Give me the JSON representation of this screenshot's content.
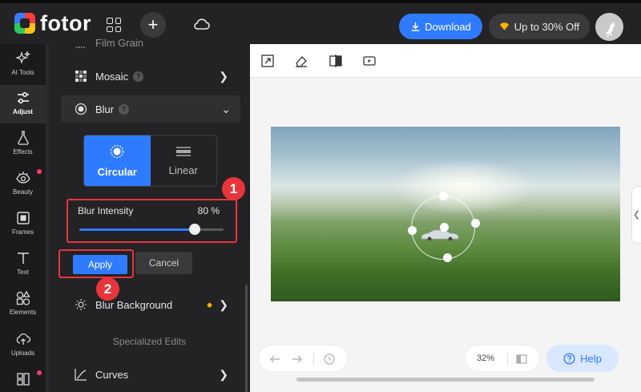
{
  "app": {
    "logo_text": "fotor"
  },
  "header": {
    "download_label": "Download",
    "offer_label": "Up to 30% Off"
  },
  "rail": {
    "items": [
      {
        "label": "AI Tools",
        "icon": "sparkle-icon"
      },
      {
        "label": "Adjust",
        "icon": "sliders-icon",
        "active": true
      },
      {
        "label": "Effects",
        "icon": "flask-icon"
      },
      {
        "label": "Beauty",
        "icon": "eye-icon"
      },
      {
        "label": "Frames",
        "icon": "frame-icon"
      },
      {
        "label": "Text",
        "icon": "text-icon"
      },
      {
        "label": "Elements",
        "icon": "shapes-icon"
      },
      {
        "label": "Uploads",
        "icon": "upload-icon"
      }
    ]
  },
  "panel": {
    "film_grain_label": "Film Grain",
    "mosaic_label": "Mosaic",
    "blur_label": "Blur",
    "blur_modes": [
      {
        "label": "Circular",
        "selected": true
      },
      {
        "label": "Linear",
        "selected": false
      }
    ],
    "intensity_label": "Blur Intensity",
    "intensity_value": 80,
    "intensity_display": "80 %",
    "apply_label": "Apply",
    "cancel_label": "Cancel",
    "blur_background_label": "Blur Background",
    "specialized_title": "Specialized Edits",
    "curves_label": "Curves",
    "callouts": [
      "1",
      "2"
    ]
  },
  "canvas": {
    "zoom_display": "32%",
    "help_label": "Help"
  },
  "colors": {
    "accent": "#2f7bff",
    "highlight": "#e8353b",
    "premium": "#f7b500"
  }
}
